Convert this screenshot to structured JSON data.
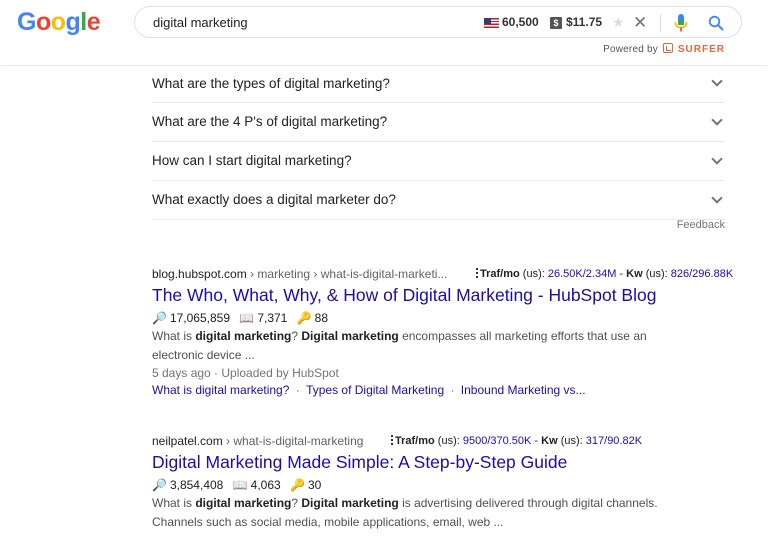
{
  "header": {
    "logo_letters": [
      {
        "ch": "G",
        "color": "#4285F4"
      },
      {
        "ch": "o",
        "color": "#EA4335"
      },
      {
        "ch": "o",
        "color": "#FBBC05"
      },
      {
        "ch": "g",
        "color": "#4285F4"
      },
      {
        "ch": "l",
        "color": "#34A853"
      },
      {
        "ch": "e",
        "color": "#EA4335"
      }
    ],
    "search_query": "digital marketing",
    "volume": "60,500",
    "cpc_badge": "$",
    "cpc": "$11.75",
    "star_glyph": "★",
    "clear_glyph": "✕",
    "powered_by": "Powered by",
    "brand": "SURFER"
  },
  "faq": {
    "questions": [
      "What are the types of digital marketing?",
      "What are the 4 P's of digital marketing?",
      "How can I start digital marketing?",
      "What exactly does a digital marketer do?"
    ],
    "feedback": "Feedback"
  },
  "results": [
    {
      "cite_domain": "blog.hubspot.com",
      "cite_path": " › marketing › what-is-digital-marketi...",
      "metrics_traf_label": "Traf/mo",
      "metrics_traf_scope": " (us): ",
      "metrics_traf_value": "26.50K/2.34M",
      "metrics_kw_label": "Kw",
      "metrics_kw_scope": " (us): ",
      "metrics_kw_value": "826/296.88K",
      "title": "The Who, What, Why, & How of Digital Marketing - HubSpot Blog",
      "stat_search": "17,065,859",
      "stat_book": "7,371",
      "stat_key": "88",
      "snippet_1a": "What is ",
      "snippet_1b": "digital marketing",
      "snippet_1c": "? ",
      "snippet_1d": "Digital marketing",
      "snippet_1e": " encompasses all marketing efforts that use an",
      "snippet_2": "electronic device ...",
      "meta": "5 days ago · Uploaded by HubSpot",
      "sitelinks": [
        "What is digital marketing?",
        "Types of Digital Marketing",
        "Inbound Marketing vs..."
      ]
    },
    {
      "cite_domain": "neilpatel.com",
      "cite_path": " › what-is-digital-marketing",
      "metrics_traf_label": "Traf/mo",
      "metrics_traf_scope": " (us): ",
      "metrics_traf_value": "9500/370.50K",
      "metrics_kw_label": "Kw",
      "metrics_kw_scope": " (us): ",
      "metrics_kw_value": "317/90.82K",
      "title": "Digital Marketing Made Simple: A Step-by-Step Guide",
      "stat_search": "3,854,408",
      "stat_book": "4,063",
      "stat_key": "30",
      "snippet_1a": "What is ",
      "snippet_1b": "digital marketing",
      "snippet_1c": "? ",
      "snippet_1d": "Digital marketing",
      "snippet_1e": " is advertising delivered through digital channels.",
      "snippet_2": "Channels such as social media, mobile applications, email, web ..."
    }
  ],
  "icons": {
    "search_stat": "🔎",
    "book_stat": "📖",
    "key_stat": "🔑",
    "sep": " · "
  }
}
